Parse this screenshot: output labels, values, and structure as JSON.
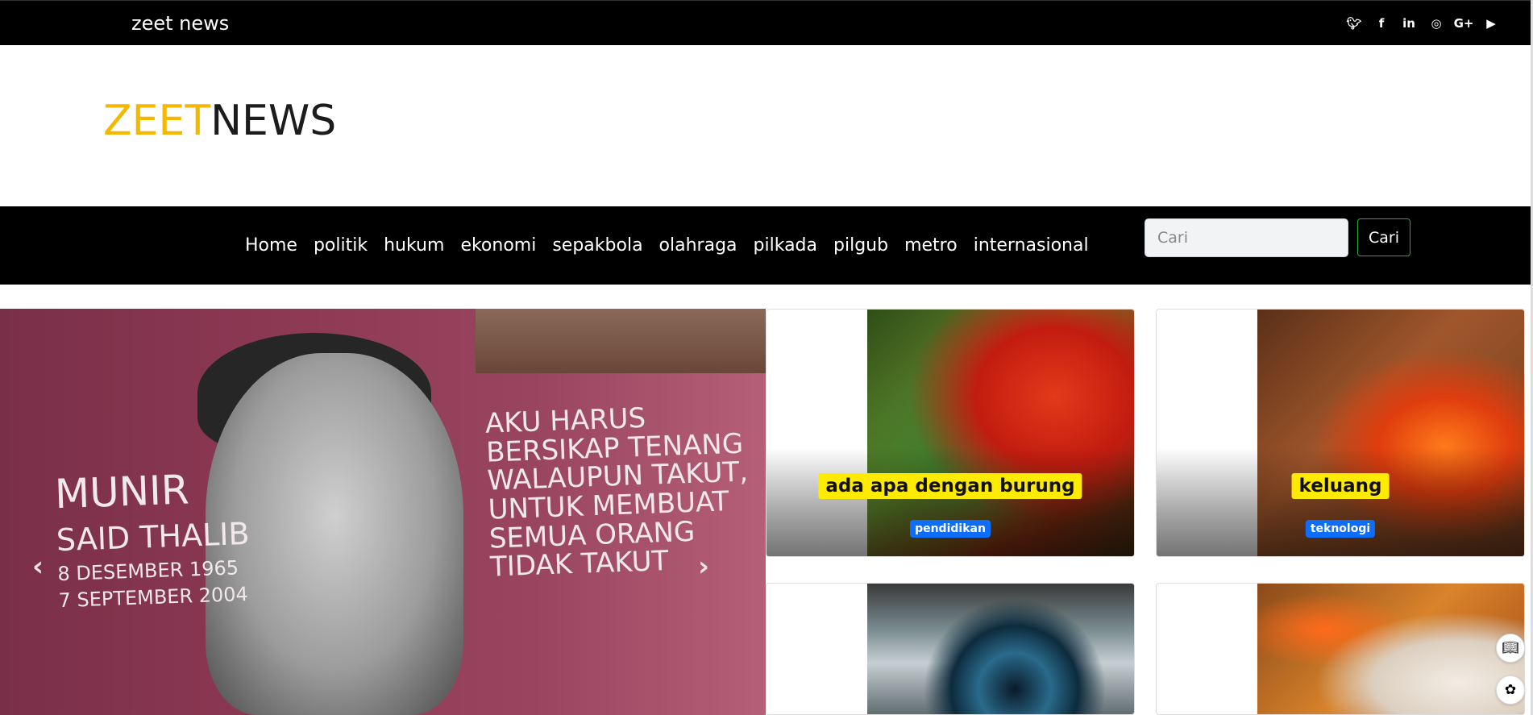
{
  "topbar": {
    "site_name": "zeet news",
    "social": [
      {
        "icon": "twitter-icon",
        "glyph": "🐦︎"
      },
      {
        "icon": "facebook-icon",
        "glyph": "f"
      },
      {
        "icon": "linkedin-icon",
        "glyph": "in"
      },
      {
        "icon": "instagram-icon",
        "glyph": "◎"
      },
      {
        "icon": "google-plus-icon",
        "glyph": "G+"
      },
      {
        "icon": "youtube-icon",
        "glyph": "▶"
      }
    ]
  },
  "logo": {
    "part1": "ZEET",
    "part2": "NEWS",
    "part1_color": "#f5b800",
    "part2_color": "#1c1c1c"
  },
  "nav": {
    "items": [
      "Home",
      "politik",
      "hukum",
      "ekonomi",
      "sepakbola",
      "olahraga",
      "pilkada",
      "pilgub",
      "metro",
      "internasional"
    ],
    "search_placeholder": "Cari",
    "search_button": "Cari"
  },
  "hero": {
    "wall_left_1": "MUNIR",
    "wall_left_2": "SAID THALIB",
    "wall_left_3": "8 DESEMBER 1965",
    "wall_left_4": "7 SEPTEMBER 2004",
    "wall_right": [
      "AKU HARUS",
      "BERSIKAP TENANG",
      "WALAUPUN TAKUT,",
      "UNTUK MEMBUAT",
      "SEMUA ORANG",
      "TIDAK TAKUT"
    ],
    "prev": "‹",
    "next": "›"
  },
  "cards": [
    {
      "title": "ada apa dengan burung",
      "category": "pendidikan",
      "image": "parrot"
    },
    {
      "title": "keluang",
      "category": "teknologi",
      "image": "autumn-leaf"
    },
    {
      "title": "",
      "category": "",
      "image": "eye"
    },
    {
      "title": "",
      "category": "",
      "image": "fox"
    }
  ],
  "colors": {
    "accent": "#f5b800",
    "badge": "#0d6efd",
    "title_bg": "#ffeb00",
    "nav_bg": "#000000",
    "search_border": "#28a745"
  }
}
